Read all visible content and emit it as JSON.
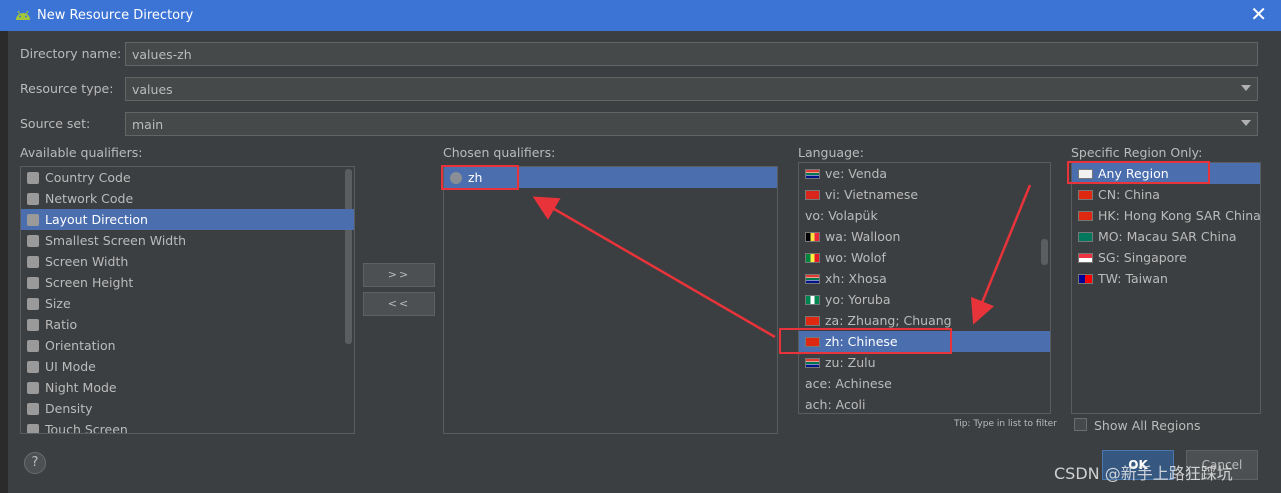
{
  "window": {
    "title": "New Resource Directory"
  },
  "form": {
    "directory_name_label": "Directory name:",
    "directory_name_value": "values-zh",
    "resource_type_label": "Resource type:",
    "resource_type_value": "values",
    "source_set_label": "Source set:",
    "source_set_value": "main"
  },
  "available": {
    "label": "Available qualifiers:",
    "items": [
      {
        "label": "Country Code",
        "icon": "country-code-icon"
      },
      {
        "label": "Network Code",
        "icon": "network-code-icon"
      },
      {
        "label": "Layout Direction",
        "icon": "layout-direction-icon"
      },
      {
        "label": "Smallest Screen Width",
        "icon": "smallest-width-icon"
      },
      {
        "label": "Screen Width",
        "icon": "screen-width-icon"
      },
      {
        "label": "Screen Height",
        "icon": "screen-height-icon"
      },
      {
        "label": "Size",
        "icon": "size-icon"
      },
      {
        "label": "Ratio",
        "icon": "ratio-icon"
      },
      {
        "label": "Orientation",
        "icon": "orientation-icon"
      },
      {
        "label": "UI Mode",
        "icon": "ui-mode-icon"
      },
      {
        "label": "Night Mode",
        "icon": "night-mode-icon"
      },
      {
        "label": "Density",
        "icon": "density-icon"
      },
      {
        "label": "Touch Screen",
        "icon": "touch-screen-icon"
      }
    ],
    "selected_index": 2
  },
  "buttons": {
    "add": ">>",
    "remove": "<<"
  },
  "chosen": {
    "label": "Chosen qualifiers:",
    "items": [
      {
        "label": "zh",
        "icon": "globe-icon"
      }
    ]
  },
  "language": {
    "label": "Language:",
    "items": [
      {
        "label": "ve: Venda",
        "flag": "za"
      },
      {
        "label": "vi: Vietnamese",
        "flag": "vn"
      },
      {
        "label": "vo: Volapük",
        "flag": ""
      },
      {
        "label": "wa: Walloon",
        "flag": "be"
      },
      {
        "label": "wo: Wolof",
        "flag": "sn"
      },
      {
        "label": "xh: Xhosa",
        "flag": "za"
      },
      {
        "label": "yo: Yoruba",
        "flag": "ng"
      },
      {
        "label": "za: Zhuang; Chuang",
        "flag": "cn"
      },
      {
        "label": "zh: Chinese",
        "flag": "cn"
      },
      {
        "label": "zu: Zulu",
        "flag": "za"
      },
      {
        "label": "ace: Achinese",
        "flag": ""
      },
      {
        "label": "ach: Acoli",
        "flag": ""
      }
    ],
    "selected_index": 8,
    "tip": "Tip: Type in list to filter"
  },
  "region": {
    "label": "Specific Region Only:",
    "items": [
      {
        "label": "Any Region",
        "flag": "blank"
      },
      {
        "label": "CN: China",
        "flag": "cn"
      },
      {
        "label": "HK: Hong Kong SAR China",
        "flag": "hk"
      },
      {
        "label": "MO: Macau SAR China",
        "flag": "mo"
      },
      {
        "label": "SG: Singapore",
        "flag": "sg"
      },
      {
        "label": "TW: Taiwan",
        "flag": "tw"
      }
    ],
    "selected_index": 0,
    "show_all_label": "Show All Regions",
    "show_all_checked": false
  },
  "footer": {
    "help": "?",
    "ok": "OK",
    "cancel": "Cancel"
  },
  "watermark": "CSDN @新手上路狂踩坑",
  "colors": {
    "selection": "#4b6eaf",
    "titlebar": "#3c74d6",
    "annotation": "#e8333a"
  }
}
